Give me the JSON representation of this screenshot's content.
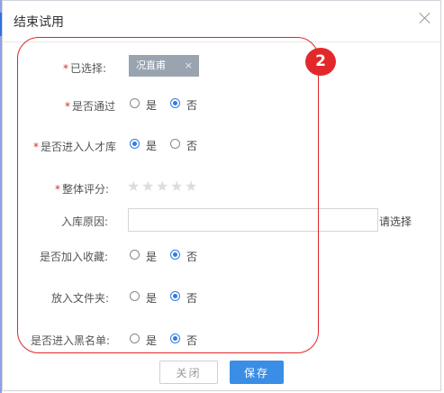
{
  "dialog": {
    "title": "结束试用",
    "close_icon": "close-icon"
  },
  "form": {
    "required_mark": "*",
    "selected": {
      "label": "已选择:",
      "tag_text": "况直甫",
      "tag_remove": "×"
    },
    "pass": {
      "label": "是否通过",
      "yes": "是",
      "no": "否",
      "value": "no"
    },
    "talent_pool": {
      "label": "是否进入人才库",
      "yes": "是",
      "no": "否",
      "value": "yes"
    },
    "overall_rating": {
      "label": "整体评分:",
      "stars_total": 5,
      "stars_value": 0,
      "star_glyph": "★"
    },
    "reason": {
      "label": "入库原因:",
      "value": "",
      "placeholder": "",
      "action_link": "请选择"
    },
    "favorite": {
      "label": "是否加入收藏:",
      "yes": "是",
      "no": "否",
      "value": "no"
    },
    "folder": {
      "label": "放入文件夹:",
      "yes": "是",
      "no": "否",
      "value": "no"
    },
    "blacklist": {
      "label": "是否进入黑名单:",
      "yes": "是",
      "no": "否",
      "value": "no"
    }
  },
  "annotation": {
    "badge": "2",
    "color": "#e0262a"
  },
  "buttons": {
    "close": "关闭",
    "save": "保存"
  },
  "colors": {
    "accent": "#3a8ee6",
    "tag_bg": "#9aa3b0",
    "required": "#e02a2a"
  }
}
